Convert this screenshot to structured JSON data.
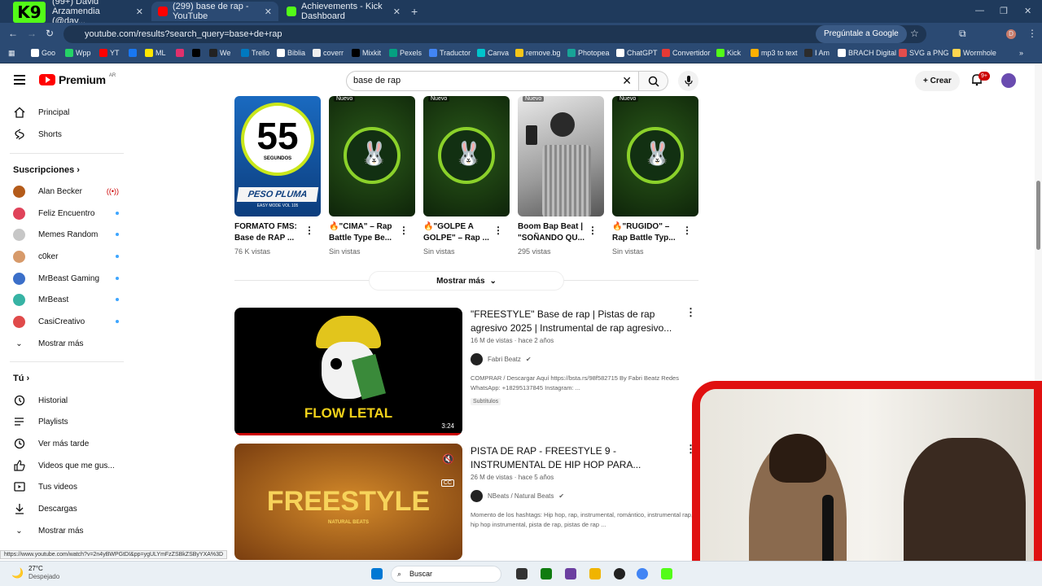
{
  "browser": {
    "tabs": [
      {
        "label": "(99+) David Arzamendia (@dav...",
        "active": false
      },
      {
        "label": "(299) base de rap - YouTube",
        "active": true
      },
      {
        "label": "Achievements - Kick Dashboard",
        "active": false
      }
    ],
    "url": "youtube.com/results?search_query=base+de+rap",
    "google_pill": "Pregúntale a Google",
    "profile_initial": "D",
    "bookmarks": [
      "Goo",
      "Wpp",
      "YT",
      "ML",
      "We",
      "Trello",
      "Biblia",
      "coverr",
      "Mixkit",
      "Pexels",
      "Traductor",
      "Canva",
      "remove.bg",
      "Photopea",
      "ChatGPT",
      "Convertidor",
      "Kick",
      "mp3 to text",
      "I Am",
      "BRACH Digital",
      "SVG a PNG",
      "Wormhole"
    ],
    "kick_overlay": "K9"
  },
  "youtube": {
    "logo_word": "Premium",
    "logo_country": "AR",
    "search_value": "base de rap",
    "crear_label": "Crear",
    "notif_badge": "9+"
  },
  "sidebar": {
    "main": [
      {
        "label": "Principal",
        "icon": "home-icon"
      },
      {
        "label": "Shorts",
        "icon": "shorts-icon"
      }
    ],
    "subs_header": "Suscripciones",
    "subs": [
      {
        "label": "Alan Becker",
        "color": "#b45b1a",
        "indicator": "live"
      },
      {
        "label": "Feliz Encuentro",
        "color": "#e0435a",
        "indicator": "dot"
      },
      {
        "label": "Memes Random",
        "color": "#c7c7c7",
        "indicator": "dot"
      },
      {
        "label": "c0ker",
        "color": "#d79a6a",
        "indicator": "dot"
      },
      {
        "label": "MrBeast Gaming",
        "color": "#3b6fc9",
        "indicator": "dot"
      },
      {
        "label": "MrBeast",
        "color": "#37b3a4",
        "indicator": "dot"
      },
      {
        "label": "CasiCreativo",
        "color": "#e04a4a",
        "indicator": "dot"
      }
    ],
    "subs_more": "Mostrar más",
    "you_header": "Tú",
    "you": [
      {
        "label": "Historial",
        "icon": "history-icon"
      },
      {
        "label": "Playlists",
        "icon": "playlist-icon"
      },
      {
        "label": "Ver más tarde",
        "icon": "clock-icon"
      },
      {
        "label": "Videos que me gus...",
        "icon": "thumbs-up-icon"
      },
      {
        "label": "Tus videos",
        "icon": "video-icon"
      },
      {
        "label": "Descargas",
        "icon": "download-icon"
      }
    ],
    "you_more": "Mostrar más"
  },
  "shorts": [
    {
      "title": "FORMATO FMS: Base de RAP ...",
      "views": "76 K vistas",
      "badge": "",
      "art": "55"
    },
    {
      "title": "🔥\"CIMA\" – Rap Battle Type Be...",
      "views": "Sin vistas",
      "badge": "Nuevo",
      "art": "bunny"
    },
    {
      "title": "🔥\"GOLPE A GOLPE\" – Rap ...",
      "views": "Sin vistas",
      "badge": "Nuevo",
      "art": "bunny"
    },
    {
      "title": "Boom Bap Beat | \"SOÑANDO QU...",
      "views": "295 vistas",
      "badge": "Nuevo",
      "art": "photo"
    },
    {
      "title": "🔥\"RUGIDO\" – Rap Battle Typ...",
      "views": "Sin vistas",
      "badge": "Nuevo",
      "art": "bunny"
    }
  ],
  "short_art": {
    "big_number": "55",
    "sub": "SEGUNDOS",
    "banner": "PESO PLUMA",
    "banner_sub": "EASY MODE  VOL 105"
  },
  "show_more": "Mostrar más",
  "videos": [
    {
      "title": "\"FREESTYLE\" Base de rap | Pistas de rap agresivo 2025 | Instrumental de rap agresivo...",
      "meta": "16 M de vistas · hace 2 años",
      "channel": "Fabri Beatz",
      "desc": "COMPRAR / Descargar Aquí https://bsta.rs/98f582715 By Fabri Beatz Redes WhatsApp: +18295137845 Instagram: ...",
      "chip": "Subtítulos",
      "thumb_text": "FLOW LETAL",
      "duration": "3:24"
    },
    {
      "title": "PISTA DE RAP - FREESTYLE 9 - INSTRUMENTAL DE HIP HOP PARA...",
      "meta": "26 M de vistas · hace 5 años",
      "channel": "NBeats / Natural Beats",
      "desc": "Momento de los hashtags: Hip hop, rap, instrumental, romántico, instrumental rap, hip hop instrumental, pista de rap, pistas de rap ...",
      "thumb_text": "FREESTYLE",
      "thumb_sub": "NATURAL BEATS"
    }
  ],
  "status_url": "https://www.youtube.com/watch?v=2n4yBWPGtDI&pp=ygULYmFzZSBkZSByYXA%3D",
  "taskbar": {
    "temp": "27°C",
    "weather": "Despejado",
    "search": "Buscar"
  }
}
